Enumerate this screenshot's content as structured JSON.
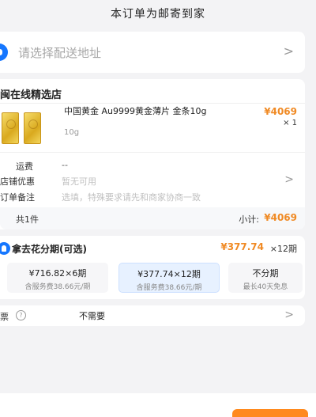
{
  "notice": "本订单为邮寄到家",
  "address": {
    "placeholder": "请选择配送地址",
    "chevron": ">"
  },
  "order": {
    "store_name": "闽在线精选店",
    "product": {
      "title": "中国黄金 Au9999黄金薄片 金条10g",
      "spec": "10g",
      "price": "¥4069",
      "quantity": "× 1"
    },
    "rows": {
      "shipping_label": "运费",
      "shipping_value": "--",
      "discount_label": "店铺优惠",
      "discount_value": "暂无可用",
      "remark_label": "订单备注",
      "remark_placeholder": "选填，特殊要求请先和商家协商一致"
    },
    "chevron": ">",
    "total_count": "共1件",
    "subtotal_label": "小计:",
    "subtotal_value": "¥4069"
  },
  "installment": {
    "title": "拿去花分期(可选)",
    "selected_price": "¥377.74",
    "selected_term": "×12期",
    "plans": [
      {
        "main": "¥716.82×6期",
        "sub": "含服务费38.66元/期",
        "selected": false
      },
      {
        "main": "¥377.74×12期",
        "sub": "含服务费38.66元/期",
        "selected": true
      },
      {
        "main": "不分期",
        "sub": "最长40天免息",
        "selected": false
      }
    ]
  },
  "invoice": {
    "label": "票",
    "help_icon": "?",
    "value": "不需要",
    "chevron": ">"
  },
  "icons": {
    "location": "location-pin-icon",
    "installment": "ant-credit-icon",
    "help": "help-circle-icon",
    "chevron": "chevron-right-icon"
  },
  "colors": {
    "accent_orange": "#f08a24",
    "brand_blue": "#1677ff",
    "submit_orange": "#ff8a1e"
  }
}
